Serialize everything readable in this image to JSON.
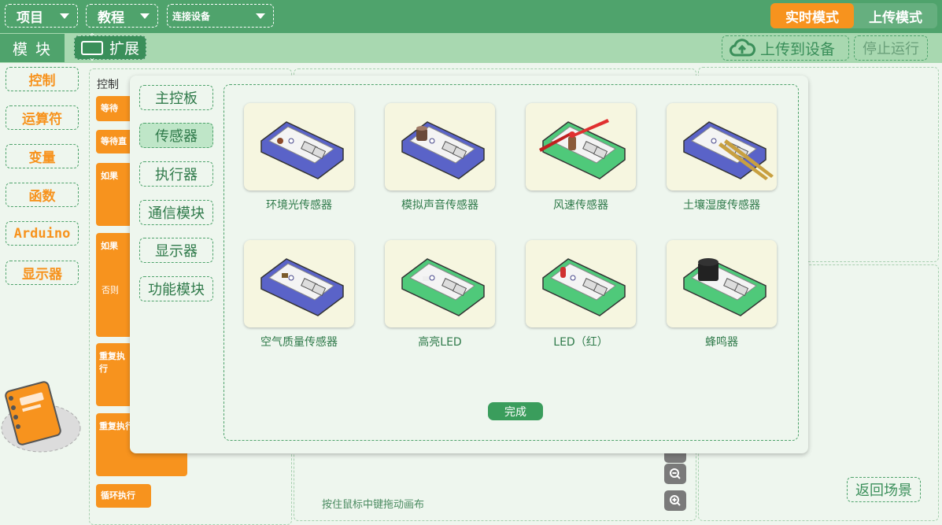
{
  "topbar": {
    "menus": [
      {
        "label": "项目"
      },
      {
        "label": "教程"
      },
      {
        "label": "连接设备"
      }
    ],
    "modes": [
      {
        "label": "实时模式",
        "active": true
      },
      {
        "label": "上传模式",
        "active": false
      }
    ],
    "accent": "#f7931e",
    "bar_color": "#4fa36c"
  },
  "toolbar": {
    "modules_label": "模 块",
    "extend_label": "扩展",
    "upload_label": "上传到设备",
    "stop_label": "停止运行"
  },
  "categories": [
    "控制",
    "运算符",
    "变量",
    "函数",
    "Arduino",
    "显示器"
  ],
  "palette": {
    "title": "控制",
    "blocks": [
      "等待",
      "等待直",
      "如果",
      "如果",
      "否则",
      "重复执行",
      "重复执行",
      "循环执行"
    ]
  },
  "canvas": {
    "hint": "按住鼠标中键拖动画布",
    "back_label": "返回场景"
  },
  "modal": {
    "categories": [
      {
        "label": "主控板",
        "active": false
      },
      {
        "label": "传感器",
        "active": true
      },
      {
        "label": "执行器",
        "active": false
      },
      {
        "label": "通信模块",
        "active": false
      },
      {
        "label": "显示器",
        "active": false
      },
      {
        "label": "功能模块",
        "active": false
      }
    ],
    "items": [
      {
        "label": "环境光传感器",
        "color": "#5a63c8",
        "part": "light"
      },
      {
        "label": "模拟声音传感器",
        "color": "#5a63c8",
        "part": "sound"
      },
      {
        "label": "风速传感器",
        "color": "#4fc97a",
        "part": "fan"
      },
      {
        "label": "土壤湿度传感器",
        "color": "#5a63c8",
        "part": "soil"
      },
      {
        "label": "空气质量传感器",
        "color": "#5a63c8",
        "part": "air"
      },
      {
        "label": "高亮LED",
        "color": "#4fc97a",
        "part": "led-white"
      },
      {
        "label": "LED（红）",
        "color": "#4fc97a",
        "part": "led-red"
      },
      {
        "label": "蜂鸣器",
        "color": "#4fc97a",
        "part": "buzzer"
      }
    ],
    "done_label": "完成"
  }
}
